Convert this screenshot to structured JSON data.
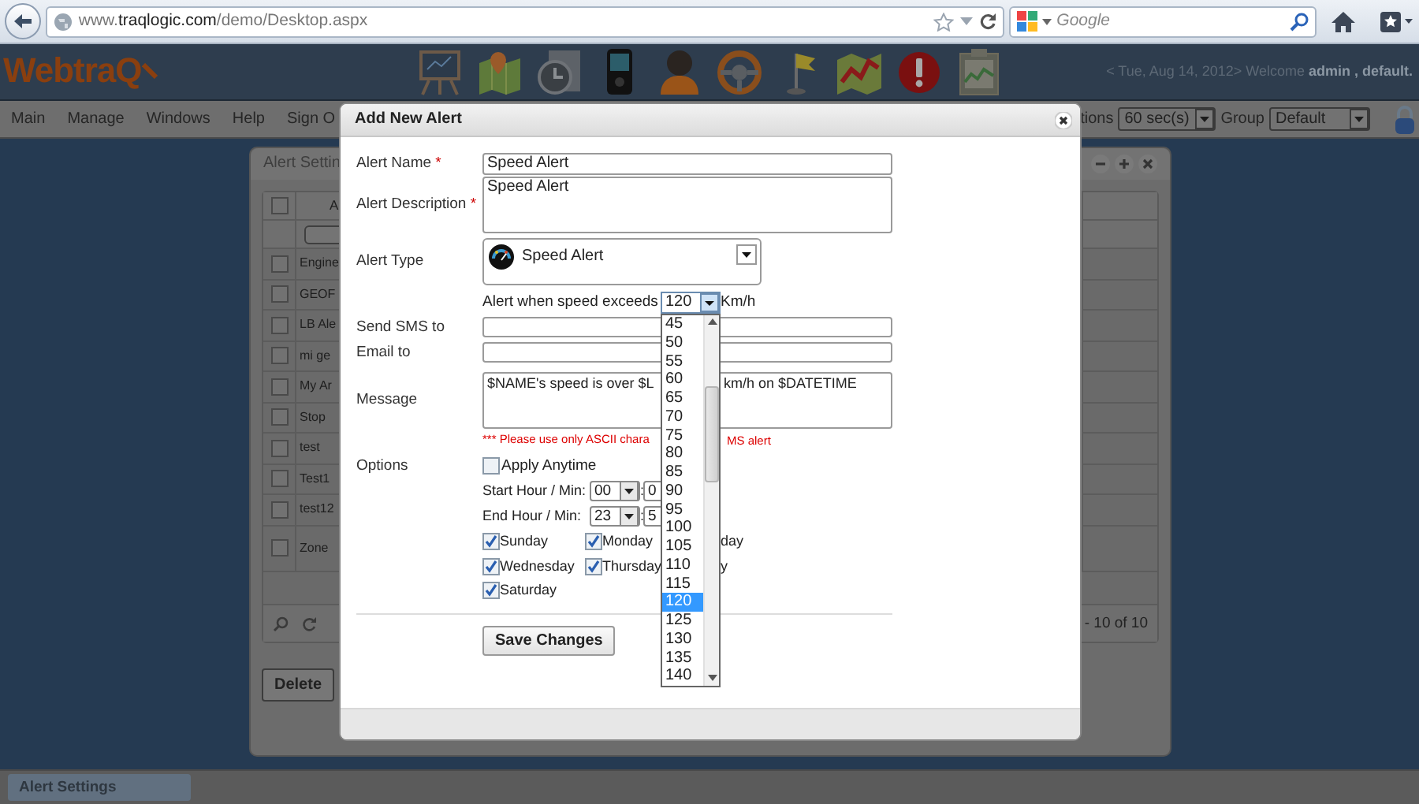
{
  "browser": {
    "url": "www.**traqlogic.com**/demo/Desktop.aspx",
    "search": {
      "placeholder": "Google"
    }
  },
  "header": {
    "logo": "WebtraQ",
    "status": "< Tue, Aug 14, 2012> Welcome **admin , default.**"
  },
  "menu": [
    {
      "label": "Main"
    },
    {
      "label": "Manage"
    },
    {
      "label": "Windows"
    },
    {
      "label": "Help"
    },
    {
      "label": "Sign O"
    }
  ],
  "menu_controls": {
    "refresh_label": "tions",
    "refresh_value": "60 sec(s)",
    "group_label": "Group",
    "group_value": "Default"
  },
  "alert_settings_window": {
    "title": "Alert Settin",
    "column_1": "A",
    "select_all_checked": false,
    "rows": [
      {
        "name": "Engine",
        "checked": false
      },
      {
        "name": "GEOF",
        "checked": false
      },
      {
        "name": "LB Ale",
        "checked": false
      },
      {
        "name": "mi ge",
        "checked": false
      },
      {
        "name": "My Ar",
        "checked": false
      },
      {
        "name": "Stop",
        "checked": false
      },
      {
        "name": "test",
        "checked": false
      },
      {
        "name": "Test1",
        "checked": false
      },
      {
        "name": "test12",
        "checked": false
      },
      {
        "name": "Zone",
        "checked": false
      }
    ],
    "pager": "- 10 of 10",
    "delete_button": "Delete"
  },
  "dialog": {
    "title": "Add New Alert",
    "alert_name": {
      "label": "Alert Name",
      "required_mark": "*",
      "value": "Speed Alert"
    },
    "alert_description": {
      "label": "Alert Description",
      "required_mark": "*",
      "value": "Speed Alert"
    },
    "alert_type": {
      "label": "Alert Type",
      "value": "Speed Alert"
    },
    "speed": {
      "label": "Alert when speed exceeds",
      "value": "120",
      "unit": "Km/h"
    },
    "send_sms": {
      "label": "Send SMS to"
    },
    "email": {
      "label": "Email to"
    },
    "message": {
      "label": "Message",
      "text_part_1": "$NAME's speed is over $L",
      "text_part_2": "km/h on $DATETIME"
    },
    "warning": {
      "part_1": "*** Please use only ASCII chara",
      "part_2": "MS alert"
    },
    "options": {
      "label": "Options",
      "apply_anytime": {
        "label": "Apply Anytime",
        "checked": false
      }
    },
    "start_time": {
      "label": "Start Hour / Min:",
      "hour": "00",
      "separator": ":",
      "minute": "0"
    },
    "end_time": {
      "label": "End Hour / Min:",
      "hour": "23",
      "separator": ":",
      "minute": "5"
    },
    "days": [
      {
        "label": "Sunday",
        "checked": true
      },
      {
        "label": "Monday",
        "checked": true
      },
      {
        "label": "day"
      },
      {
        "label": "Wednesday",
        "checked": true
      },
      {
        "label": "Thursday",
        "checked": true
      },
      {
        "label": "y"
      },
      {
        "label": "Saturday",
        "checked": true
      }
    ],
    "save_button": "Save Changes"
  },
  "speed_dropdown": {
    "options": [
      {
        "label": "45",
        "selected": false
      },
      {
        "label": "50",
        "selected": false
      },
      {
        "label": "55",
        "selected": false
      },
      {
        "label": "60",
        "selected": false
      },
      {
        "label": "65",
        "selected": false
      },
      {
        "label": "70",
        "selected": false
      },
      {
        "label": "75",
        "selected": false
      },
      {
        "label": "80",
        "selected": false
      },
      {
        "label": "85",
        "selected": false
      },
      {
        "label": "90",
        "selected": false
      },
      {
        "label": "95",
        "selected": false
      },
      {
        "label": "100",
        "selected": false
      },
      {
        "label": "105",
        "selected": false
      },
      {
        "label": "110",
        "selected": false
      },
      {
        "label": "115",
        "selected": false
      },
      {
        "label": "120",
        "selected": true
      },
      {
        "label": "125",
        "selected": false
      },
      {
        "label": "130",
        "selected": false
      },
      {
        "label": "135",
        "selected": false
      },
      {
        "label": "140",
        "selected": false
      }
    ]
  },
  "taskbar": [
    {
      "label": "Alert Settings"
    }
  ]
}
